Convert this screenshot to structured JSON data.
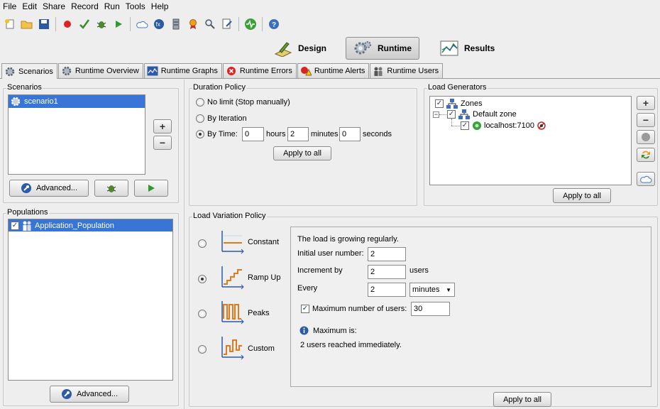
{
  "menu": [
    "File",
    "Edit",
    "Share",
    "Record",
    "Run",
    "Tools",
    "Help"
  ],
  "toolbar": {
    "icons": [
      "new-icon",
      "open-icon",
      "save-icon",
      "record-icon",
      "check-icon",
      "debug-bug-icon",
      "play-icon",
      "cloud-icon",
      "fx-icon",
      "server-icon",
      "award-icon",
      "search-icon",
      "edit-doc-icon",
      "monitor-icon",
      "help-icon"
    ]
  },
  "modes": {
    "design": "Design",
    "runtime": "Runtime",
    "results": "Results"
  },
  "tabs": [
    {
      "label": "Scenarios",
      "icon": "gear-icon"
    },
    {
      "label": "Runtime Overview",
      "icon": "gear-icon"
    },
    {
      "label": "Runtime Graphs",
      "icon": "graph-icon"
    },
    {
      "label": "Runtime Errors",
      "icon": "error-icon"
    },
    {
      "label": "Runtime Alerts",
      "icon": "alert-icon"
    },
    {
      "label": "Runtime Users",
      "icon": "users-icon"
    }
  ],
  "scenarios": {
    "title": "Scenarios",
    "items": [
      "scenario1"
    ],
    "advanced_label": "Advanced..."
  },
  "populations": {
    "title": "Populations",
    "items": [
      "Application_Population"
    ],
    "advanced_label": "Advanced..."
  },
  "duration": {
    "title": "Duration Policy",
    "no_limit": "No limit (Stop manually)",
    "by_iteration": "By Iteration",
    "by_time": "By Time:",
    "hours_value": "0",
    "hours_label": "hours",
    "minutes_value": "2",
    "minutes_label": "minutes",
    "seconds_value": "0",
    "seconds_label": "seconds",
    "apply": "Apply to all"
  },
  "load_generators": {
    "title": "Load Generators",
    "zones": "Zones",
    "default_zone": "Default zone",
    "host": "localhost:7100",
    "apply": "Apply to all"
  },
  "load_variation": {
    "title": "Load Variation Policy",
    "options": [
      "Constant",
      "Ramp Up",
      "Peaks",
      "Custom"
    ],
    "selected": "Ramp Up",
    "description": "The load is growing regularly.",
    "initial_label": "Initial user number:",
    "initial_value": "2",
    "increment_label": "Increment by",
    "increment_value": "2",
    "increment_unit": "users",
    "every_label": "Every",
    "every_value": "2",
    "every_unit": "minutes",
    "max_label": "Maximum number of users:",
    "max_value": "30",
    "max_checked": true,
    "info_title": "Maximum is:",
    "info_text": "2 users reached immediately.",
    "apply": "Apply to all"
  },
  "colors": {
    "selection": "#3875d7",
    "accent_orange": "#e07a1f",
    "axis_blue": "#2a5aa8"
  }
}
